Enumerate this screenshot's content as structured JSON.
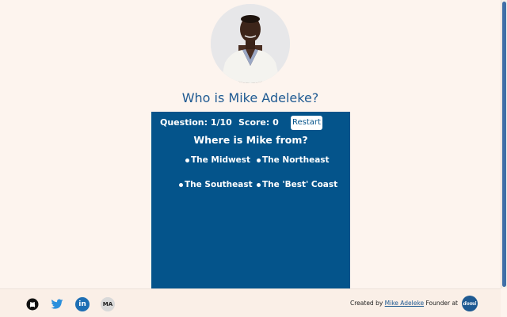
{
  "header": {
    "avatar_alt": "Mike Adeleke",
    "title": "Who is Mike Adeleke?"
  },
  "quiz": {
    "question_counter": "Question: 1/10",
    "score": "Score: 0",
    "restart_label": "Restart",
    "question": "Where is Mike from?",
    "options": [
      "The Midwest",
      "The Northeast",
      "The Southeast",
      "The 'Best' Coast"
    ],
    "background_color": "#04548b"
  },
  "footer": {
    "social_links": [
      {
        "icon": "github-icon"
      },
      {
        "icon": "twitter-icon"
      },
      {
        "icon": "linkedin-icon",
        "text": "in"
      },
      {
        "icon": "ma-logo-icon",
        "text": "MA"
      }
    ],
    "credit_prefix": "Created by",
    "credit_name": "Mike Adeleke",
    "credit_suffix": "Founder at",
    "brand_logo_text": "domi"
  },
  "colors": {
    "page_background": "#fdf4ee",
    "title": "#1f5a92",
    "quiz_panel": "#04548b"
  }
}
